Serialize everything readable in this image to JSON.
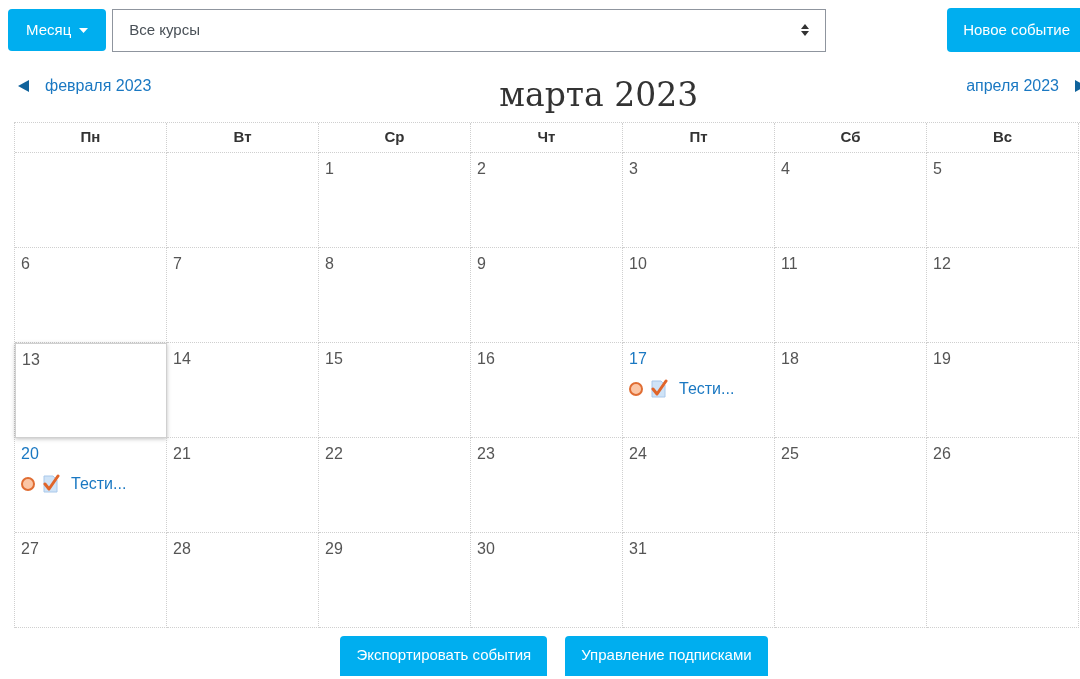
{
  "view_button": {
    "label": "Месяц"
  },
  "course_select": {
    "value": "Все курсы"
  },
  "new_event_button": {
    "label": "Новое событие"
  },
  "prev_month": {
    "label": "февраля 2023"
  },
  "title": "марта 2023",
  "next_month": {
    "label": "апреля 2023"
  },
  "weekdays": [
    "Пн",
    "Вт",
    "Ср",
    "Чт",
    "Пт",
    "Сб",
    "Вс"
  ],
  "weeks": [
    [
      {
        "kind": "blank"
      },
      {
        "kind": "blank"
      },
      {
        "kind": "day",
        "day": "1",
        "today": false
      },
      {
        "kind": "day",
        "day": "2",
        "today": false
      },
      {
        "kind": "day",
        "day": "3",
        "today": false
      },
      {
        "kind": "day",
        "day": "4",
        "today": false
      },
      {
        "kind": "day",
        "day": "5",
        "today": false
      }
    ],
    [
      {
        "kind": "day",
        "day": "6",
        "today": false
      },
      {
        "kind": "day",
        "day": "7",
        "today": false
      },
      {
        "kind": "day",
        "day": "8",
        "today": false
      },
      {
        "kind": "day",
        "day": "9",
        "today": false
      },
      {
        "kind": "day",
        "day": "10",
        "today": false
      },
      {
        "kind": "day",
        "day": "11",
        "today": false
      },
      {
        "kind": "day",
        "day": "12",
        "today": false
      }
    ],
    [
      {
        "kind": "day",
        "day": "13",
        "today": true
      },
      {
        "kind": "day",
        "day": "14",
        "today": false
      },
      {
        "kind": "day",
        "day": "15",
        "today": false
      },
      {
        "kind": "day",
        "day": "16",
        "today": false
      },
      {
        "kind": "day",
        "day": "17",
        "today": false,
        "events": [
          {
            "title": "Тести..."
          }
        ]
      },
      {
        "kind": "day",
        "day": "18",
        "today": false
      },
      {
        "kind": "day",
        "day": "19",
        "today": false
      }
    ],
    [
      {
        "kind": "day",
        "day": "20",
        "today": false,
        "events": [
          {
            "title": "Тести..."
          }
        ]
      },
      {
        "kind": "day",
        "day": "21",
        "today": false
      },
      {
        "kind": "day",
        "day": "22",
        "today": false
      },
      {
        "kind": "day",
        "day": "23",
        "today": false
      },
      {
        "kind": "day",
        "day": "24",
        "today": false
      },
      {
        "kind": "day",
        "day": "25",
        "today": false
      },
      {
        "kind": "day",
        "day": "26",
        "today": false
      }
    ],
    [
      {
        "kind": "day",
        "day": "27",
        "today": false
      },
      {
        "kind": "day",
        "day": "28",
        "today": false
      },
      {
        "kind": "day",
        "day": "29",
        "today": false
      },
      {
        "kind": "day",
        "day": "30",
        "today": false
      },
      {
        "kind": "day",
        "day": "31",
        "today": false
      },
      {
        "kind": "blank"
      },
      {
        "kind": "blank"
      }
    ]
  ],
  "footer_buttons": [
    {
      "label": "Экспортировать события"
    },
    {
      "label": "Управление подписками"
    }
  ]
}
